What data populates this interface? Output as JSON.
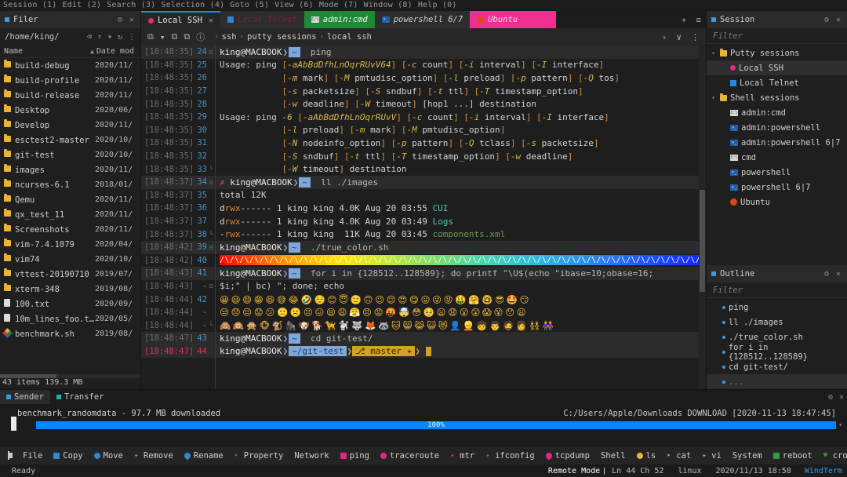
{
  "menubar": {
    "items": [
      "Session (1)",
      "Edit (2)",
      "Search (3)",
      "Selection (4)",
      "Goto (5)",
      "View (6)",
      "Mode (7)",
      "Window (8)",
      "Help (0)"
    ]
  },
  "filer": {
    "title": "Filer",
    "gear_icon": "⚙",
    "close_icon": "✕",
    "path": "/home/king/",
    "back_icon": "⌫",
    "up_icon": "↑",
    "dropdown_icon": "▾",
    "refresh_icon": "↻",
    "more_icon": "⋮",
    "col_name": "Name",
    "col_date": "Date mod",
    "sort_icon": "▲",
    "rows": [
      {
        "icon": "folder",
        "name": "build-debug",
        "date": "2020/11/"
      },
      {
        "icon": "folder",
        "name": "build-profile",
        "date": "2020/11/"
      },
      {
        "icon": "folder",
        "name": "build-release",
        "date": "2020/11/"
      },
      {
        "icon": "folder",
        "name": "Desktop",
        "date": "2020/06/"
      },
      {
        "icon": "folder",
        "name": "Develop",
        "date": "2020/11/"
      },
      {
        "icon": "folder",
        "name": "esctest2-master",
        "date": "2020/10/"
      },
      {
        "icon": "folder",
        "name": "git-test",
        "date": "2020/10/"
      },
      {
        "icon": "folder",
        "name": "images",
        "date": "2020/11/"
      },
      {
        "icon": "folder",
        "name": "ncurses-6.1",
        "date": "2018/01/"
      },
      {
        "icon": "folder",
        "name": "Qemu",
        "date": "2020/11/"
      },
      {
        "icon": "folder",
        "name": "qx_test_11",
        "date": "2020/11/"
      },
      {
        "icon": "folder",
        "name": "Screenshots",
        "date": "2020/11/"
      },
      {
        "icon": "folder",
        "name": "vim-7.4.1079",
        "date": "2020/04/"
      },
      {
        "icon": "folder",
        "name": "vim74",
        "date": "2020/10/"
      },
      {
        "icon": "folder",
        "name": "vttest-20190710",
        "date": "2019/07/"
      },
      {
        "icon": "folder",
        "name": "xterm-348",
        "date": "2019/08/"
      },
      {
        "icon": "file",
        "name": "100.txt",
        "date": "2020/09/"
      },
      {
        "icon": "file",
        "name": "10m_lines_foo.t…",
        "date": "2020/05/"
      },
      {
        "icon": "sh",
        "name": "benchmark.sh",
        "date": "2019/08/"
      }
    ],
    "footer": "43 items 139.3 MB"
  },
  "tabs": {
    "items": [
      {
        "label": "Local SSH",
        "icon": "dot-pink",
        "active": true,
        "closable": true
      },
      {
        "label": "Local Telnet",
        "icon": "sq-blue",
        "active": false,
        "style": "telnet"
      },
      {
        "label": "admin:cmd",
        "icon": "cmd",
        "active": false,
        "style": "cmd"
      },
      {
        "label": "powershell 6/7",
        "icon": "ps",
        "active": false,
        "style": "ps"
      },
      {
        "label": "Ubuntu",
        "icon": "ubuntu",
        "active": false,
        "style": "ubuntu"
      }
    ],
    "add_icon": "+",
    "list_icon": "≡"
  },
  "termtool": {
    "new_icon": "⧉",
    "dropdown_icon": "▾",
    "close_icon": "⧉",
    "clone_icon": "⧉",
    "info_icon": "ⓘ",
    "breadcrumb": [
      "ssh",
      "putty sessions",
      "local ssh"
    ],
    "sep": "›",
    "fwd_icon": "›",
    "chev_icon": "∨",
    "more_icon": "⋮"
  },
  "terminal": {
    "lines": [
      {
        "ts": "[18:48:35]",
        "ln": "24",
        "fold": "⊟",
        "type": "prompt",
        "user": "king@MACBOOK",
        "seg": "~",
        "cmd": "ping"
      },
      {
        "ts": "[18:48:35]",
        "ln": "25",
        "fold": "",
        "type": "text",
        "html": "Usage: ping [-aAbBdDfhLnOqrRUvV64] [-c count] [-i interval] [-I interface]"
      },
      {
        "ts": "[18:48:35]",
        "ln": "26",
        "fold": "",
        "type": "text",
        "html": "            [-m mark] [-M pmtudisc_option] [-l preload] [-p pattern] [-Q tos]"
      },
      {
        "ts": "[18:48:35]",
        "ln": "27",
        "fold": "",
        "type": "text",
        "html": "            [-s packetsize] [-S sndbuf] [-t ttl] [-T timestamp_option]"
      },
      {
        "ts": "[18:48:35]",
        "ln": "28",
        "fold": "",
        "type": "text",
        "html": "            [-w deadline] [-W timeout] [hop1 ...] destination"
      },
      {
        "ts": "[18:48:35]",
        "ln": "29",
        "fold": "",
        "type": "text",
        "html": "Usage: ping -6 [-aAbBdDfhLnOqrRUvV] [-c count] [-i interval] [-I interface]"
      },
      {
        "ts": "[18:48:35]",
        "ln": "30",
        "fold": "",
        "type": "text",
        "html": "            [-l preload] [-m mark] [-M pmtudisc_option]"
      },
      {
        "ts": "[18:48:35]",
        "ln": "31",
        "fold": "",
        "type": "text",
        "html": "            [-N nodeinfo_option] [-p pattern] [-Q tclass] [-s packetsize]"
      },
      {
        "ts": "[18:48:35]",
        "ln": "32",
        "fold": "",
        "type": "text",
        "html": "            [-S sndbuf] [-t ttl] [-T timestamp_option] [-w deadline]"
      },
      {
        "ts": "[18:48:35]",
        "ln": "33",
        "fold": "└",
        "type": "text",
        "html": "            [-W timeout] destination"
      },
      {
        "ts": "[18:48:37]",
        "ln": "34",
        "fold": "⊟",
        "type": "prompt",
        "marker": "✗",
        "user": "king@MACBOOK",
        "seg": "~",
        "cmd": "ll ./images"
      },
      {
        "ts": "[18:48:37]",
        "ln": "35",
        "fold": "",
        "type": "text",
        "html": "total 12K"
      },
      {
        "ts": "[18:48:37]",
        "ln": "36",
        "fold": "",
        "type": "ls",
        "perm": "drwx------",
        "rest": "1 king king 4.0K Aug 20 03:55",
        "name": "CUI",
        "nameclass": "c-cyan"
      },
      {
        "ts": "[18:48:37]",
        "ln": "37",
        "fold": "",
        "type": "ls",
        "perm": "drwx------",
        "rest": "1 king king 4.0K Aug 20 03:49",
        "name": "Logs",
        "nameclass": "c-cyan"
      },
      {
        "ts": "[18:48:37]",
        "ln": "38",
        "fold": "└",
        "type": "ls",
        "perm": "-rwx------",
        "rest": "1 king king  11K Aug 20 03:45",
        "name": "components.xml",
        "nameclass": "c-green"
      },
      {
        "ts": "[18:48:42]",
        "ln": "39",
        "fold": "⊟",
        "type": "prompt",
        "user": "king@MACBOOK",
        "seg": "~",
        "cmd": "./true_color.sh"
      },
      {
        "ts": "[18:48:42]",
        "ln": "40",
        "fold": "",
        "type": "rainbow",
        "glyphs": "/\\/\\/\\/\\/\\/\\/\\/\\/\\/\\/\\/\\/\\/\\/\\/\\/\\/\\/\\/\\/\\/\\/\\/\\/\\/\\/\\/\\/\\/\\/\\/\\/\\/\\/\\/\\/\\/\\/\\/\\/\\/\\/\\/\\/\\/\\/\\/\\/\\/\\/\\/\\/\\/\\/\\/\\/\\/\\/\\"
      },
      {
        "ts": "[18:48:43]",
        "ln": "41",
        "fold": "",
        "type": "prompt",
        "user": "king@MACBOOK",
        "seg": "~",
        "cmd": "for i in {128512..128589}; do printf \"\\U$(echo \"ibase=10;obase=16;"
      },
      {
        "ts": "[18:48:43]",
        "ln": "-",
        "fold": "⊟",
        "type": "text",
        "html": "$i;\" | bc) \"; done; echo"
      },
      {
        "ts": "[18:48:44]",
        "ln": "42",
        "fold": "",
        "type": "emoji",
        "glyphs": "😀😃😄😁😆😅😂🤣☺️😊😇🙂🙃😉😌😍😋😛😜😝🤑🤗🤓😎🤩😏"
      },
      {
        "ts": "[18:48:44]",
        "ln": "-",
        "fold": "",
        "type": "emoji",
        "glyphs": "😒😞😔😟😕🙁☹️😣😖😫😩😤😠😡🤬🤯😳🥺😦😧😮😲😱😵😯😦"
      },
      {
        "ts": "[18:48:44]",
        "ln": "-",
        "fold": "└",
        "type": "emoji",
        "glyphs": "🙈🙉🙊🐵🐒🦍🐶🐕🦮🐩🐺🦊🦝🐱😸😹😺😻👤👱🧒👨🧔👩👯👭"
      },
      {
        "ts": "[18:48:47]",
        "ln": "43",
        "fold": "",
        "type": "prompt",
        "user": "king@MACBOOK",
        "seg": "~",
        "cmd": "cd git-test/"
      },
      {
        "ts": "[18:48:47]",
        "ln": "44",
        "fold": "",
        "type": "gitprompt",
        "current": true,
        "user": "king@MACBOOK",
        "seg": "~/git-test",
        "branch": "⎇ master ✦",
        "cursor": true
      }
    ]
  },
  "session_panel": {
    "title": "Session",
    "gear_icon": "⚙",
    "close_icon": "✕",
    "filter_placeholder": "Filter",
    "groups": [
      {
        "label": "Putty sessions",
        "icon": "folder",
        "caret": "▾",
        "items": [
          {
            "label": "Local SSH",
            "icon": "dot-pink",
            "selected": true
          },
          {
            "label": "Local Telnet",
            "icon": "sq-blue",
            "selected": false
          }
        ]
      },
      {
        "label": "Shell sessions",
        "icon": "folder",
        "caret": "▾",
        "items": [
          {
            "label": "admin:cmd",
            "icon": "cmd"
          },
          {
            "label": "admin:powershell",
            "icon": "ps"
          },
          {
            "label": "admin:powershell 6|7",
            "icon": "ps"
          },
          {
            "label": "cmd",
            "icon": "cmd"
          },
          {
            "label": "powershell",
            "icon": "ps"
          },
          {
            "label": "powershell 6|7",
            "icon": "ps"
          },
          {
            "label": "Ubuntu",
            "icon": "ubuntu"
          }
        ]
      }
    ]
  },
  "outline_panel": {
    "title": "Outline",
    "gear_icon": "⚙",
    "close_icon": "✕",
    "filter_placeholder": "Filter",
    "items": [
      {
        "label": "ping",
        "selected": false
      },
      {
        "label": "ll ./images",
        "selected": false
      },
      {
        "label": "./true_color.sh",
        "selected": false
      },
      {
        "label": "for i in {128512..128589}",
        "selected": false
      },
      {
        "label": "cd git-test/",
        "selected": false
      },
      {
        "label": "...",
        "selected": true
      }
    ]
  },
  "transfer": {
    "tabs": [
      {
        "label": "Sender",
        "color": "#3b9ae1",
        "active": true
      },
      {
        "label": "Transfer",
        "color": "#19b5a4",
        "active": false
      }
    ],
    "gear_icon": "⚙",
    "close_icon": "✕",
    "item_name": "benchmark_randomdata - 97.7 MB downloaded",
    "item_right": "C:/Users/Apple/Downloads DOWNLOAD [2020-11-13 18:47:45]",
    "progress_label": "100%",
    "progress_pct": 100,
    "caret_icon": "▾"
  },
  "bottom_toolbar": {
    "buttons": [
      {
        "label": "File",
        "glyph": "none"
      },
      {
        "label": "Copy",
        "glyph": "sq",
        "color": "#2f86d6"
      },
      {
        "label": "Move",
        "glyph": "dot",
        "color": "#2f86d6"
      },
      {
        "label": "Remove",
        "glyph": "star",
        "color": "#49a9e8"
      },
      {
        "label": "Rename",
        "glyph": "pin",
        "color": "#2f86d6"
      },
      {
        "label": "Property",
        "glyph": "tri",
        "color": "#2f86d6"
      },
      {
        "label": "Network",
        "glyph": "none"
      },
      {
        "label": "ping",
        "glyph": "sq",
        "color": "#e8267e"
      },
      {
        "label": "traceroute",
        "glyph": "dot",
        "color": "#e8267e"
      },
      {
        "label": "mtr",
        "glyph": "star",
        "color": "#e8267e"
      },
      {
        "label": "ifconfig",
        "glyph": "star",
        "color": "#e8267e"
      },
      {
        "label": "tcpdump",
        "glyph": "pin",
        "color": "#e8267e"
      },
      {
        "label": "Shell",
        "glyph": "none"
      },
      {
        "label": "ls",
        "glyph": "dot",
        "color": "#e8b339"
      },
      {
        "label": "cat",
        "glyph": "tri",
        "color": "#e8b339"
      },
      {
        "label": "vi",
        "glyph": "star",
        "color": "#e8b339"
      },
      {
        "label": "System",
        "glyph": "none"
      },
      {
        "label": "reboot",
        "glyph": "sq",
        "color": "#2f9e3f"
      },
      {
        "label": "crontab",
        "glyph": "heart",
        "color": "#2f9e3f"
      }
    ],
    "gear_icon": "⚙",
    "close_icon": "✕"
  },
  "statusbar": {
    "left": "Ready",
    "mode": "Remote Mode",
    "position": "Ln 44 Ch 52",
    "os": "linux",
    "datetime": "2020/11/13 18:58",
    "app": "WindTerm"
  }
}
